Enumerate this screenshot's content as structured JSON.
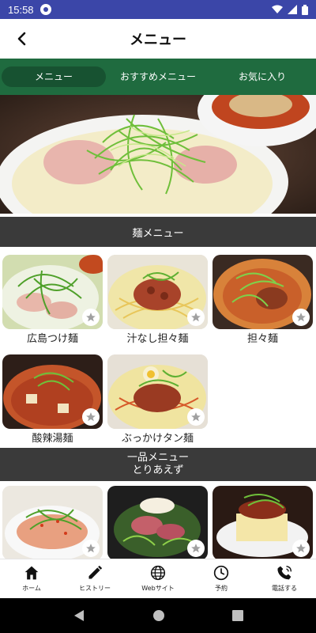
{
  "status_bar": {
    "time": "15:58"
  },
  "header": {
    "title": "メニュー"
  },
  "tabs": [
    {
      "label": "メニュー"
    },
    {
      "label": "おすすめメニュー"
    },
    {
      "label": "お気に入り"
    }
  ],
  "sections": [
    {
      "title_lines": [
        "麺メニュー"
      ],
      "items": [
        {
          "label": "広島つけ麺"
        },
        {
          "label": "汁なし担々麺"
        },
        {
          "label": "担々麺"
        },
        {
          "label": "酸辣湯麺"
        },
        {
          "label": "ぶっかけタン麺"
        }
      ]
    },
    {
      "title_lines": [
        "一品メニュー",
        "とりあえず"
      ],
      "items": [
        {
          "label": ""
        },
        {
          "label": ""
        },
        {
          "label": ""
        }
      ]
    }
  ],
  "bottom_nav": [
    {
      "label": "ホーム",
      "icon": "home-icon"
    },
    {
      "label": "ヒストリー",
      "icon": "pen-icon"
    },
    {
      "label": "Webサイト",
      "icon": "globe-icon"
    },
    {
      "label": "予約",
      "icon": "clock-icon"
    },
    {
      "label": "電話する",
      "icon": "phone-icon"
    }
  ],
  "colors": {
    "status_bar": "#3b46a8",
    "tab_bar": "#1f6b3f",
    "tab_active": "#175231",
    "section_header": "#3a3a3a"
  }
}
